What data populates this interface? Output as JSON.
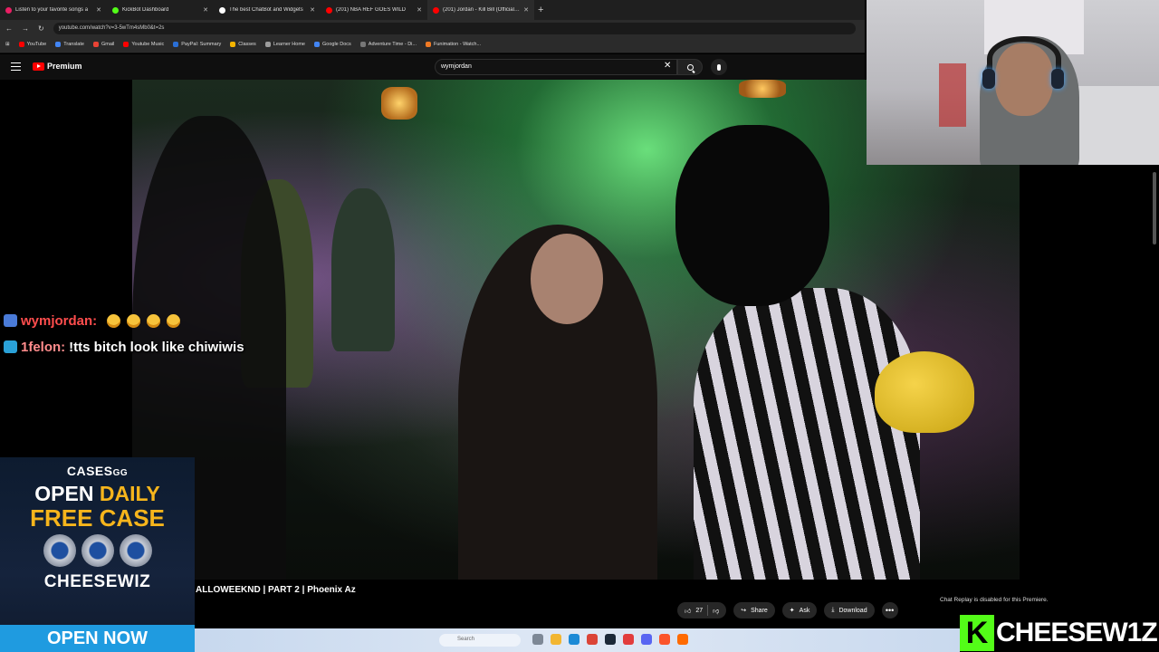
{
  "browser": {
    "tabs": [
      {
        "label": "Listen to your favorite songs a",
        "color": "#e91e63"
      },
      {
        "label": "KickBot Dashboard",
        "color": "#53fc18"
      },
      {
        "label": "The best ChatBot and Widgets",
        "color": "#ffffff"
      },
      {
        "label": "(201) NBA REF GOES WILD",
        "color": "#ff0000"
      },
      {
        "label": "(201) Jordan - Kill Bill (Official M",
        "color": "#ff0000"
      }
    ],
    "url": "youtube.com/watch?v=3-5wTm4sMb0&t=2s",
    "bookmarks": [
      {
        "label": "YouTube",
        "color": "#ff0000"
      },
      {
        "label": "Translate",
        "color": "#4285f4"
      },
      {
        "label": "Gmail",
        "color": "#ea4335"
      },
      {
        "label": "Youtube Music",
        "color": "#ff0000"
      },
      {
        "label": "PayPal: Summary",
        "color": "#2a6fd6"
      },
      {
        "label": "Classes",
        "color": "#f4b400"
      },
      {
        "label": "Learner Home",
        "color": "#9c9c9c"
      },
      {
        "label": "Google Docs",
        "color": "#4285f4"
      },
      {
        "label": "Adventure Time - Di...",
        "color": "#777777"
      },
      {
        "label": "Funimation - Watch...",
        "color": "#f07a24"
      }
    ]
  },
  "youtube": {
    "logo": "Premium",
    "search_value": "wymjordan",
    "video_title": "ALLOWEEKND | PART 2 | Phoenix Az",
    "likes": "27",
    "share_label": "Share",
    "ask_label": "Ask",
    "download_label": "Download",
    "chat_replay_notice": "Chat Replay is disabled for this Premiere."
  },
  "chat": [
    {
      "user": "wymjordan:",
      "message": "",
      "emoji_count": 4
    },
    {
      "user": "1felon:",
      "message": "!tts bitch look like chiwiwis"
    }
  ],
  "ad": {
    "brand": "CASES",
    "brand_suffix": "GG",
    "line1_a": "OPEN",
    "line1_b": "DAILY",
    "line2": "FREE CASE",
    "name": "CHEESEWIZ",
    "cta": "OPEN NOW"
  },
  "taskbar": {
    "search_placeholder": "Search"
  },
  "banner": {
    "k": "K",
    "channel": "CHEESEW1Z"
  },
  "colors": {
    "accent_red": "#ff0000",
    "kick_green": "#53fc18",
    "ad_gold": "#f6b51c",
    "ad_blue": "#1f9be0"
  }
}
